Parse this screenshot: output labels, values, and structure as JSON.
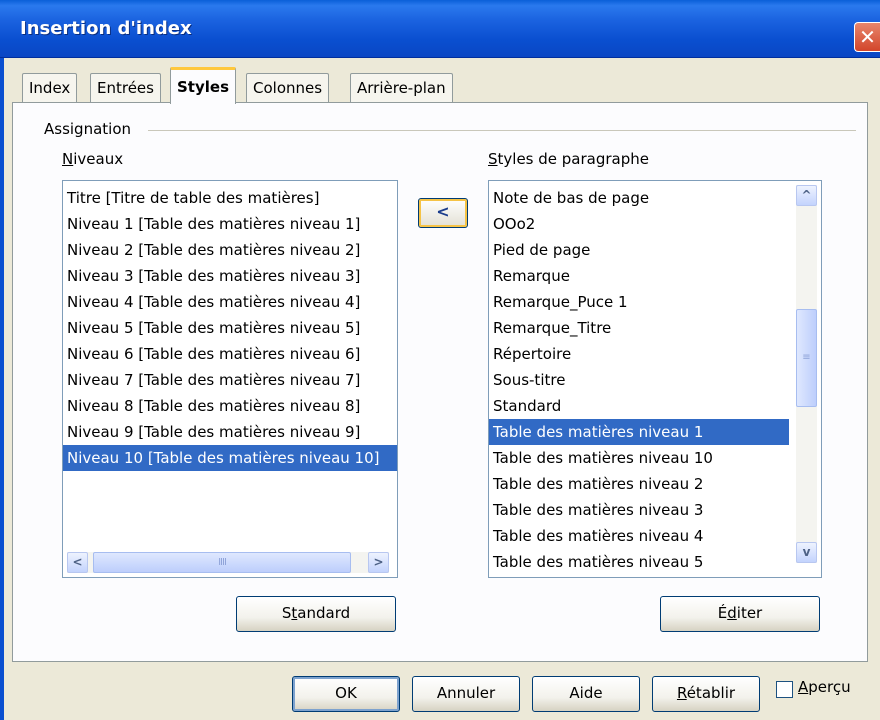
{
  "window": {
    "title": "Insertion d'index",
    "close_glyph": "✕"
  },
  "tabs": [
    {
      "label": "Index"
    },
    {
      "label": "Entrées"
    },
    {
      "label": "Styles",
      "active": true
    },
    {
      "label": "Colonnes"
    },
    {
      "label": "Arrière-plan"
    }
  ],
  "assignation": {
    "group_label": "Assignation",
    "levels_label_mnemonic": "N",
    "levels_label_rest": "iveaux",
    "styles_label_mnemonic": "S",
    "styles_label_rest": "tyles de paragraphe",
    "assign_button_glyph": "<"
  },
  "levels": [
    "Titre [Titre de table des matières]",
    "Niveau 1 [Table des matières niveau 1]",
    "Niveau 2 [Table des matières niveau 2]",
    "Niveau 3 [Table des matières niveau 3]",
    "Niveau 4 [Table des matières niveau 4]",
    "Niveau 5 [Table des matières niveau 5]",
    "Niveau 6 [Table des matières niveau 6]",
    "Niveau 7 [Table des matières niveau 7]",
    "Niveau 8 [Table des matières niveau 8]",
    "Niveau 9 [Table des matières niveau 9]",
    "Niveau 10 [Table des matières niveau 10]"
  ],
  "levels_selected_index": 10,
  "paragraph_styles": [
    "Note de bas de page",
    "OOo2",
    "Pied de page",
    "Remarque",
    "Remarque_Puce 1",
    "Remarque_Titre",
    "Répertoire",
    "Sous-titre",
    "Standard",
    "Table des matières niveau 1",
    "Table des matières niveau 10",
    "Table des matières niveau 2",
    "Table des matières niveau 3",
    "Table des matières niveau 4",
    "Table des matières niveau 5"
  ],
  "styles_selected_index": 9,
  "scroll_glyphs": {
    "left": "<",
    "right": ">",
    "up": "^",
    "down": "v",
    "grip_h": "IIII",
    "grip_v": "≡"
  },
  "buttons": {
    "standard_pre": "S",
    "standard_mn": "t",
    "standard_post": "andard",
    "edit_pre": "É",
    "edit_mn": "d",
    "edit_post": "iter",
    "ok": "OK",
    "cancel": "Annuler",
    "help": "Aide",
    "reset_mn": "R",
    "reset_post": "établir"
  },
  "preview": {
    "mn": "A",
    "rest": "perçu",
    "checked": false
  }
}
